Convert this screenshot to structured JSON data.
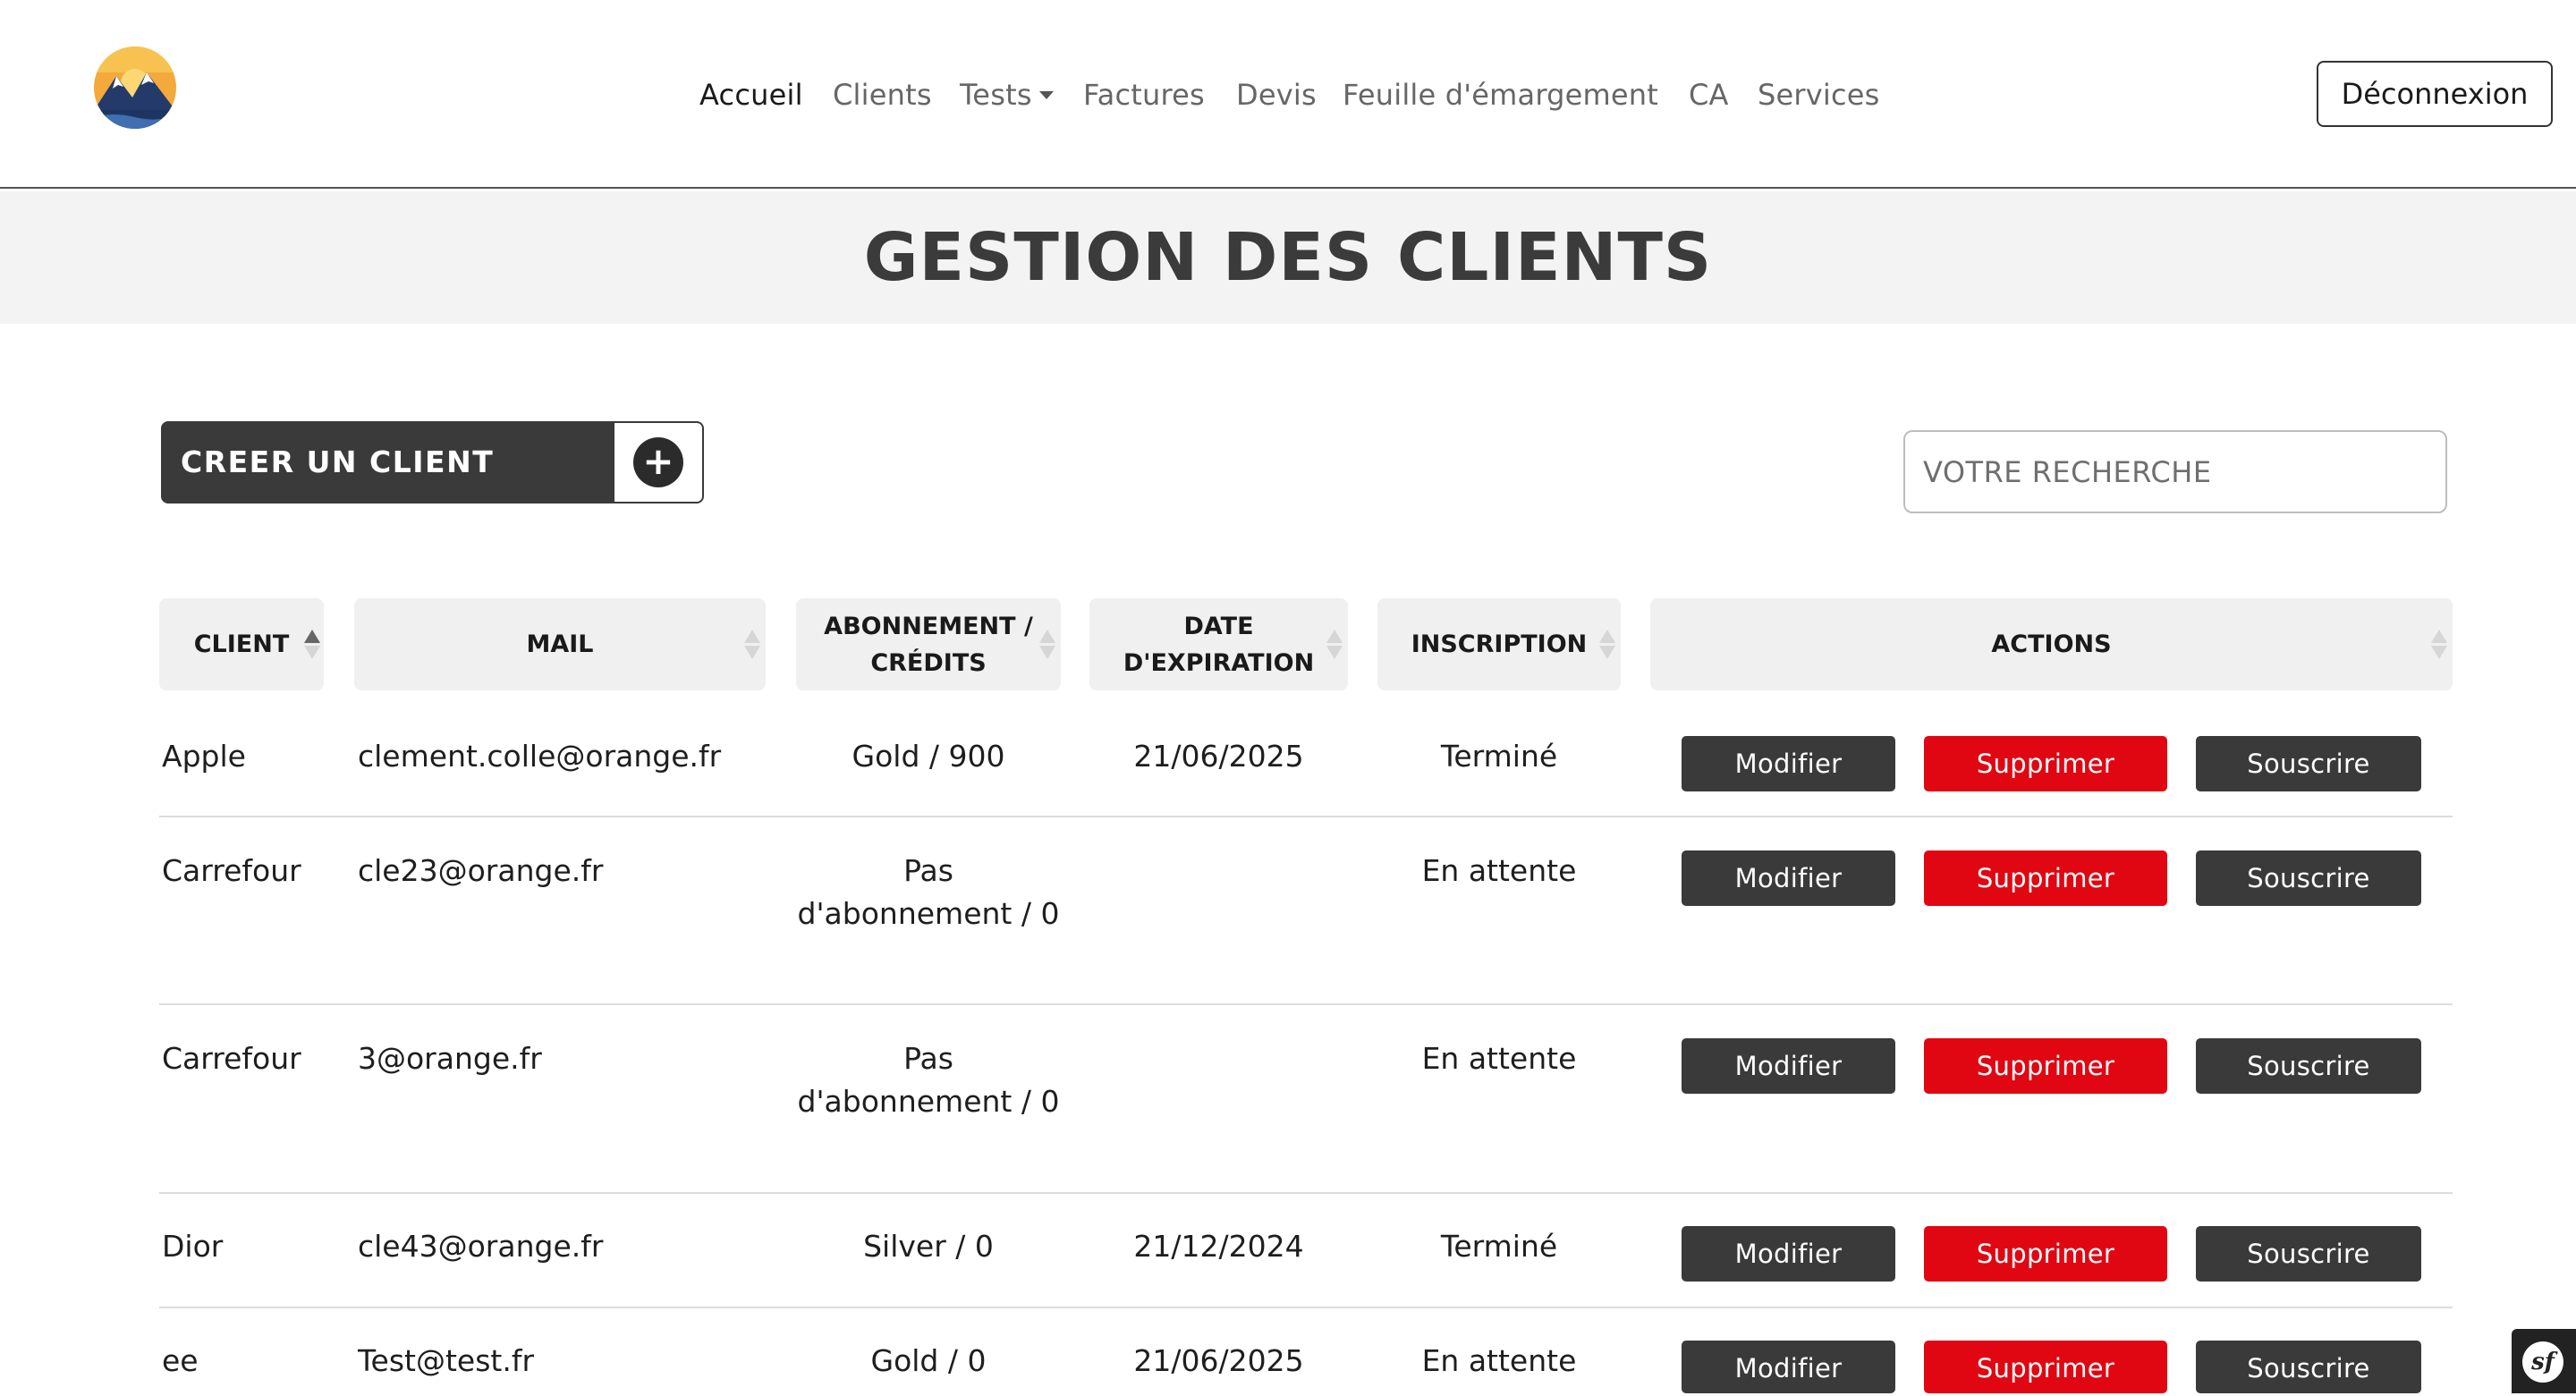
{
  "nav": {
    "items": [
      {
        "label": "Accueil",
        "active": true
      },
      {
        "label": "Clients"
      },
      {
        "label": "Tests",
        "dropdown": true
      },
      {
        "label": "Factures"
      },
      {
        "label": "Devis"
      },
      {
        "label": "Feuille d'émargement"
      },
      {
        "label": "CA"
      },
      {
        "label": "Services"
      }
    ],
    "logout_label": "Déconnexion",
    "logo_icon": "mountain-sunset-logo"
  },
  "page": {
    "title": "GESTION DES CLIENTS"
  },
  "toolbar": {
    "create_label": "CREER UN CLIENT",
    "create_icon": "plus-circle-icon",
    "search_placeholder": "VOTRE RECHERCHE"
  },
  "table": {
    "columns": [
      {
        "label": "CLIENT",
        "sort": "asc"
      },
      {
        "label": "MAIL",
        "sort": "none"
      },
      {
        "label": "ABONNEMENT / CRÉDITS",
        "sort": "none"
      },
      {
        "label": "DATE D'EXPIRATION",
        "sort": "none"
      },
      {
        "label": "INSCRIPTION",
        "sort": "none"
      },
      {
        "label": "ACTIONS",
        "sort": "none"
      }
    ],
    "action_labels": {
      "edit": "Modifier",
      "delete": "Supprimer",
      "subscribe": "Souscrire"
    },
    "rows": [
      {
        "client": "Apple",
        "mail": "clement.colle@orange.fr",
        "abonnement": "Gold / 900",
        "expiration": "21/06/2025",
        "inscription": "Terminé"
      },
      {
        "client": "Carrefour",
        "mail": "cle23@orange.fr",
        "abonnement": "Pas d'abonnement / 0",
        "expiration": "",
        "inscription": "En attente"
      },
      {
        "client": "Carrefour",
        "mail": "3@orange.fr",
        "abonnement": "Pas d'abonnement / 0",
        "expiration": "",
        "inscription": "En attente"
      },
      {
        "client": "Dior",
        "mail": "cle43@orange.fr",
        "abonnement": "Silver / 0",
        "expiration": "21/12/2024",
        "inscription": "Terminé"
      },
      {
        "client": "ee",
        "mail": "Test@test.fr",
        "abonnement": "Gold / 0",
        "expiration": "21/06/2025",
        "inscription": "En attente"
      }
    ]
  },
  "colors": {
    "dark": "#3a3a3a",
    "danger": "#e00712",
    "band": "#f3f3f3"
  },
  "debug_toolbar": {
    "icon": "symfony-icon",
    "label": "sf"
  }
}
